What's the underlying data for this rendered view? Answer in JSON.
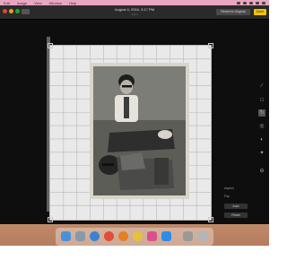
{
  "menubar": {
    "items": [
      "Edit",
      "Image",
      "View",
      "Window",
      "Help"
    ]
  },
  "window": {
    "title": "August 4, 2016, 3:17 PM",
    "subtitle": "1 of 1"
  },
  "toolbar": {
    "revert_label": "Revert to Original",
    "done_label": "Done"
  },
  "side_panel": {
    "aspect_label": "Aspect",
    "flip_label": "Flip",
    "auto_label": "Auto",
    "reset_label": "Reset"
  },
  "colors": {
    "menubar": "#e9a6c0",
    "done_button": "#f2c200",
    "traffic_close": "#e0443e",
    "traffic_minimize": "#dea123",
    "traffic_zoom": "#1aab29"
  },
  "tools": [
    "adjust-icon",
    "crop-icon",
    "rotate-icon",
    "filter-icon",
    "retouch-icon",
    "redeye-icon",
    "more-icon"
  ],
  "dock_icons": [
    "finder-icon",
    "launchpad-icon",
    "safari-icon",
    "chrome-icon",
    "firefox-icon",
    "photos-icon",
    "itunes-icon",
    "appstore-icon",
    "system-prefs-icon",
    "trash-icon"
  ]
}
